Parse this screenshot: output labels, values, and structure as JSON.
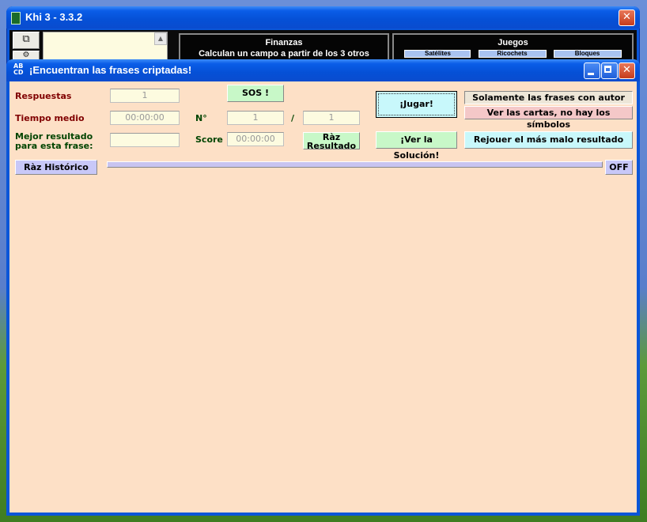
{
  "back_window": {
    "title": "Khi 3 - 3.3.2",
    "close_label": "✕",
    "panels": [
      {
        "title": "Finanzas",
        "desc": "Calculan un campo a partir de los 3 otros"
      },
      {
        "title": "Juegos",
        "buttons": [
          "Satélites",
          "Ricochets",
          "Bloques"
        ]
      }
    ]
  },
  "dialog": {
    "title": "¡Encuentran las frases criptadas!",
    "labels": {
      "respuestas": "Respuestas",
      "tiempo_medio": "Tiempo medio",
      "mejor_resultado": "Mejor resultado para esta frase:",
      "numero": "N°",
      "slash": "/",
      "score": "Score"
    },
    "fields": {
      "respuestas": "1",
      "tiempo_medio": "00:00:00",
      "mejor_resultado": "",
      "numero": "1",
      "total": "1",
      "score": "00:00:00"
    },
    "buttons": {
      "sos": "SOS !",
      "raz_resultado": "Ràz Resultado",
      "jugar": "¡Jugar!",
      "ver_solucion": "¡Ver la Solución!",
      "solo_autor": "Solamente las frases con autor",
      "ver_cartas": "Ver las cartas, no hay los símbolos",
      "rejouer": "Rejouer el más malo resultado",
      "raz_historico": "Ràz Histórico",
      "off": "OFF"
    }
  }
}
